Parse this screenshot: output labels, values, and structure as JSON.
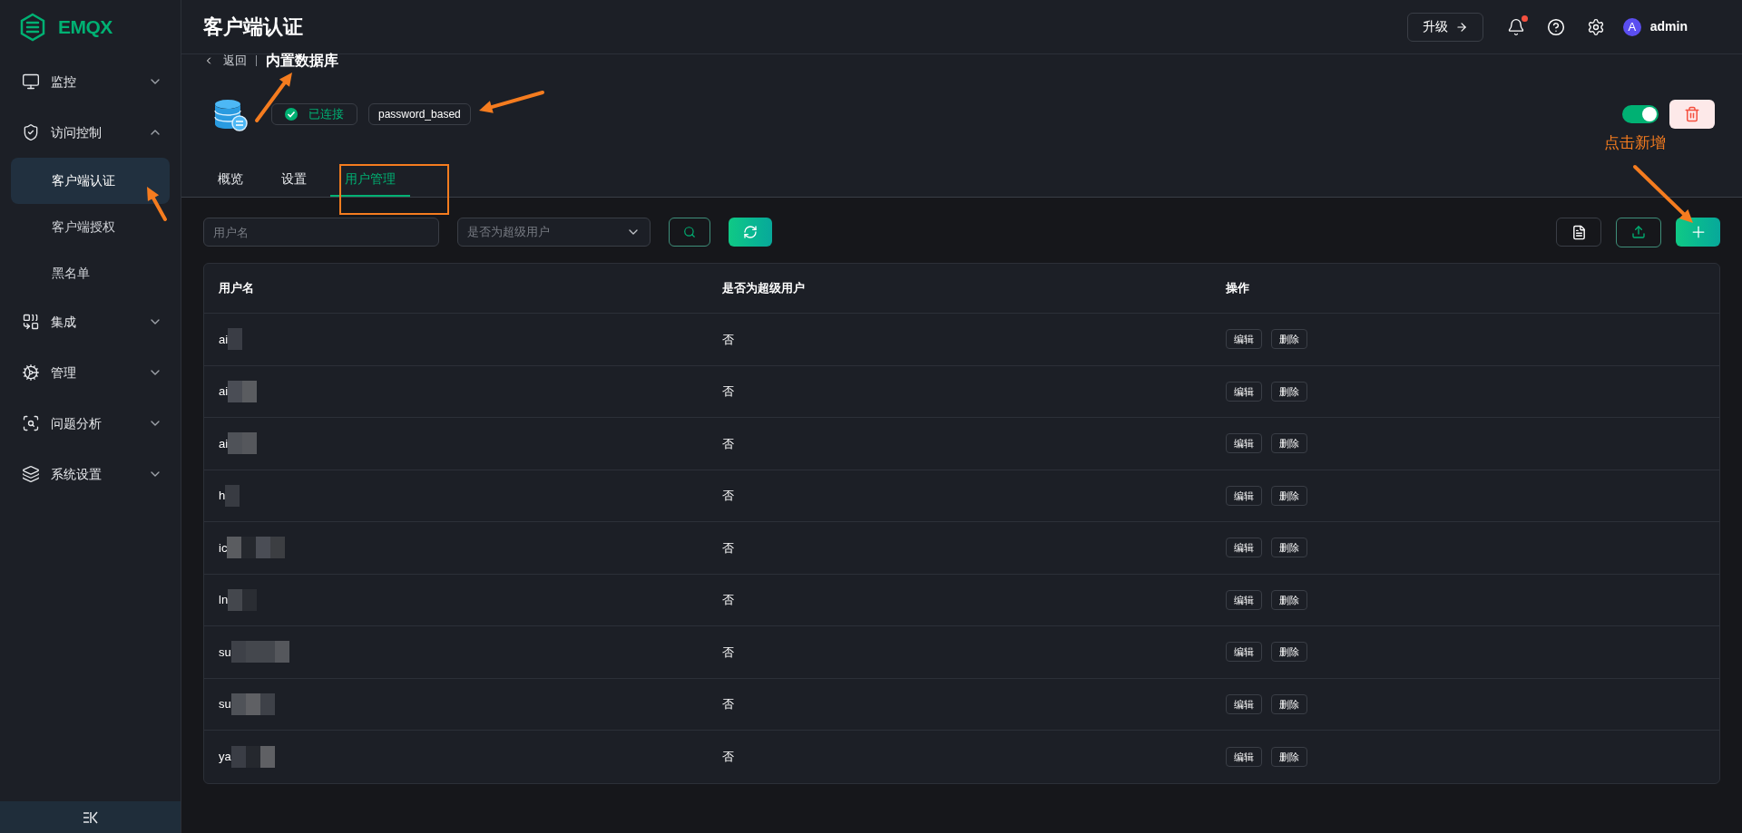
{
  "sidebar": {
    "logo": "EMQX",
    "items": [
      {
        "label": "监控",
        "expanded": false
      },
      {
        "label": "访问控制",
        "expanded": true,
        "children": [
          {
            "label": "客户端认证",
            "selected": true
          },
          {
            "label": "客户端授权",
            "selected": false
          },
          {
            "label": "黑名单",
            "selected": false
          }
        ]
      },
      {
        "label": "集成",
        "expanded": false
      },
      {
        "label": "管理",
        "expanded": false
      },
      {
        "label": "问题分析",
        "expanded": false
      },
      {
        "label": "系统设置",
        "expanded": false
      }
    ]
  },
  "header": {
    "title": "客户端认证",
    "upgrade_button": "升级",
    "unread_notifications": true,
    "user": {
      "avatar": "A",
      "name": "admin"
    }
  },
  "breadcrumb": {
    "back": "返回",
    "current": "内置数据库"
  },
  "source": {
    "status": "已连接",
    "connected": true,
    "mechanism": "password_based",
    "enabled": true
  },
  "tabs": [
    {
      "label": "概览",
      "selected": false
    },
    {
      "label": "设置",
      "selected": false
    },
    {
      "label": "用户管理",
      "selected": true
    }
  ],
  "filters": {
    "username_placeholder": "用户名",
    "superuser_placeholder": "是否为超级用户"
  },
  "table": {
    "columns": [
      "用户名",
      "是否为超级用户",
      "操作"
    ],
    "rows": [
      {
        "username": "ai",
        "superuser": "否",
        "actions": [
          "编辑",
          "删除"
        ]
      },
      {
        "username": "ai",
        "superuser": "否",
        "actions": [
          "编辑",
          "删除"
        ]
      },
      {
        "username": "ai",
        "superuser": "否",
        "actions": [
          "编辑",
          "删除"
        ]
      },
      {
        "username": "h",
        "superuser": "否",
        "actions": [
          "编辑",
          "删除"
        ]
      },
      {
        "username": "ic",
        "superuser": "否",
        "actions": [
          "编辑",
          "删除"
        ]
      },
      {
        "username": "ln",
        "superuser": "否",
        "actions": [
          "编辑",
          "删除"
        ]
      },
      {
        "username": "su",
        "superuser": "否",
        "actions": [
          "编辑",
          "删除"
        ]
      },
      {
        "username": "su",
        "superuser": "否",
        "actions": [
          "编辑",
          "删除"
        ]
      },
      {
        "username": "ya",
        "superuser": "否",
        "actions": [
          "编辑",
          "删除"
        ]
      }
    ]
  },
  "annotation": {
    "note": "点击新增"
  }
}
